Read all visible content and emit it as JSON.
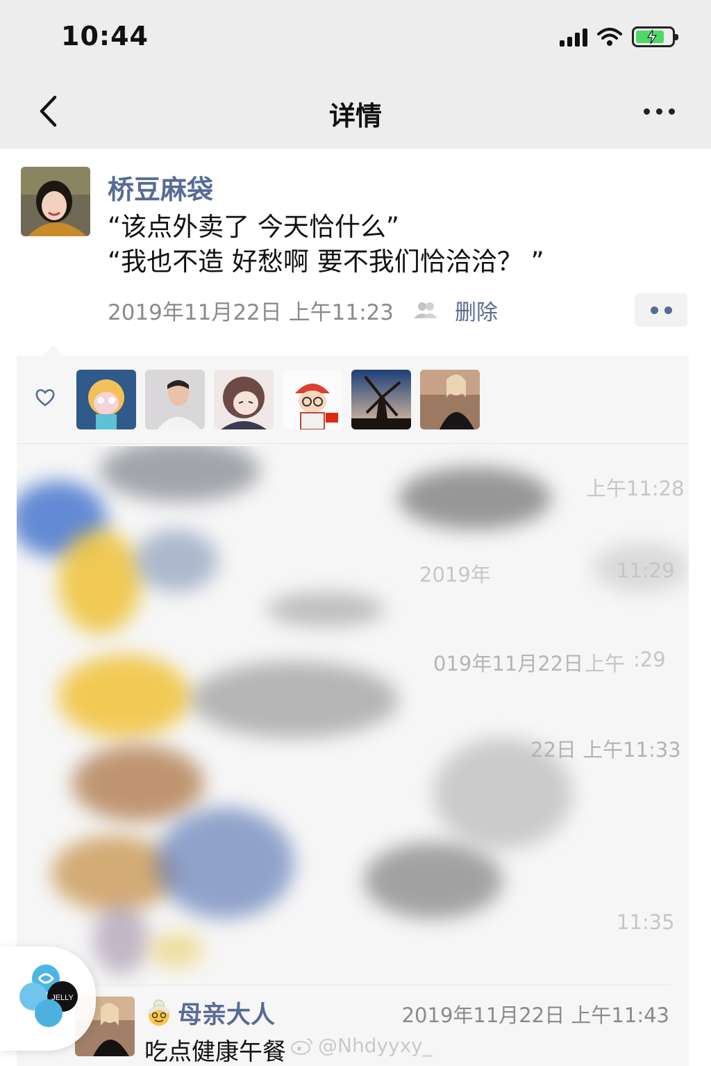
{
  "status_bar": {
    "time": "10:44",
    "battery_color": "#4cd964"
  },
  "nav": {
    "title": "详情",
    "back_icon": "chevron-left-icon",
    "more_icon": "more-horizontal-icon"
  },
  "post": {
    "author": "桥豆麻袋",
    "lines": [
      "“该点外卖了 今天恰什么”",
      "“我也不造 好愁啊 要不我们恰洽洽？ ”"
    ],
    "timestamp": "2019年11月22日 上午11:23",
    "visibility_icon": "people-icon",
    "delete_label": "删除"
  },
  "likes": {
    "icon": "heart-outline-icon",
    "avatars": [
      "cartoon-star",
      "man-white-shirt",
      "anime-girl",
      "cartoon-girl-red-hat",
      "windmill-sunset",
      "woman-black-coat"
    ]
  },
  "comments_faded_times": [
    "上午11:28",
    "2019年",
    "11:29",
    "019年11月22日",
    "上午",
    ":29",
    "22日 上午11:33",
    "11:35"
  ],
  "last_comment": {
    "emoji": "grandma-emoji",
    "name": "母亲大人",
    "time": "2019年11月22日 上午11:43",
    "text": "吃点健康午餐"
  },
  "watermark": "@Nhdyyxy_",
  "floating_logo_text": "JELLY",
  "link_color": "#576b95"
}
